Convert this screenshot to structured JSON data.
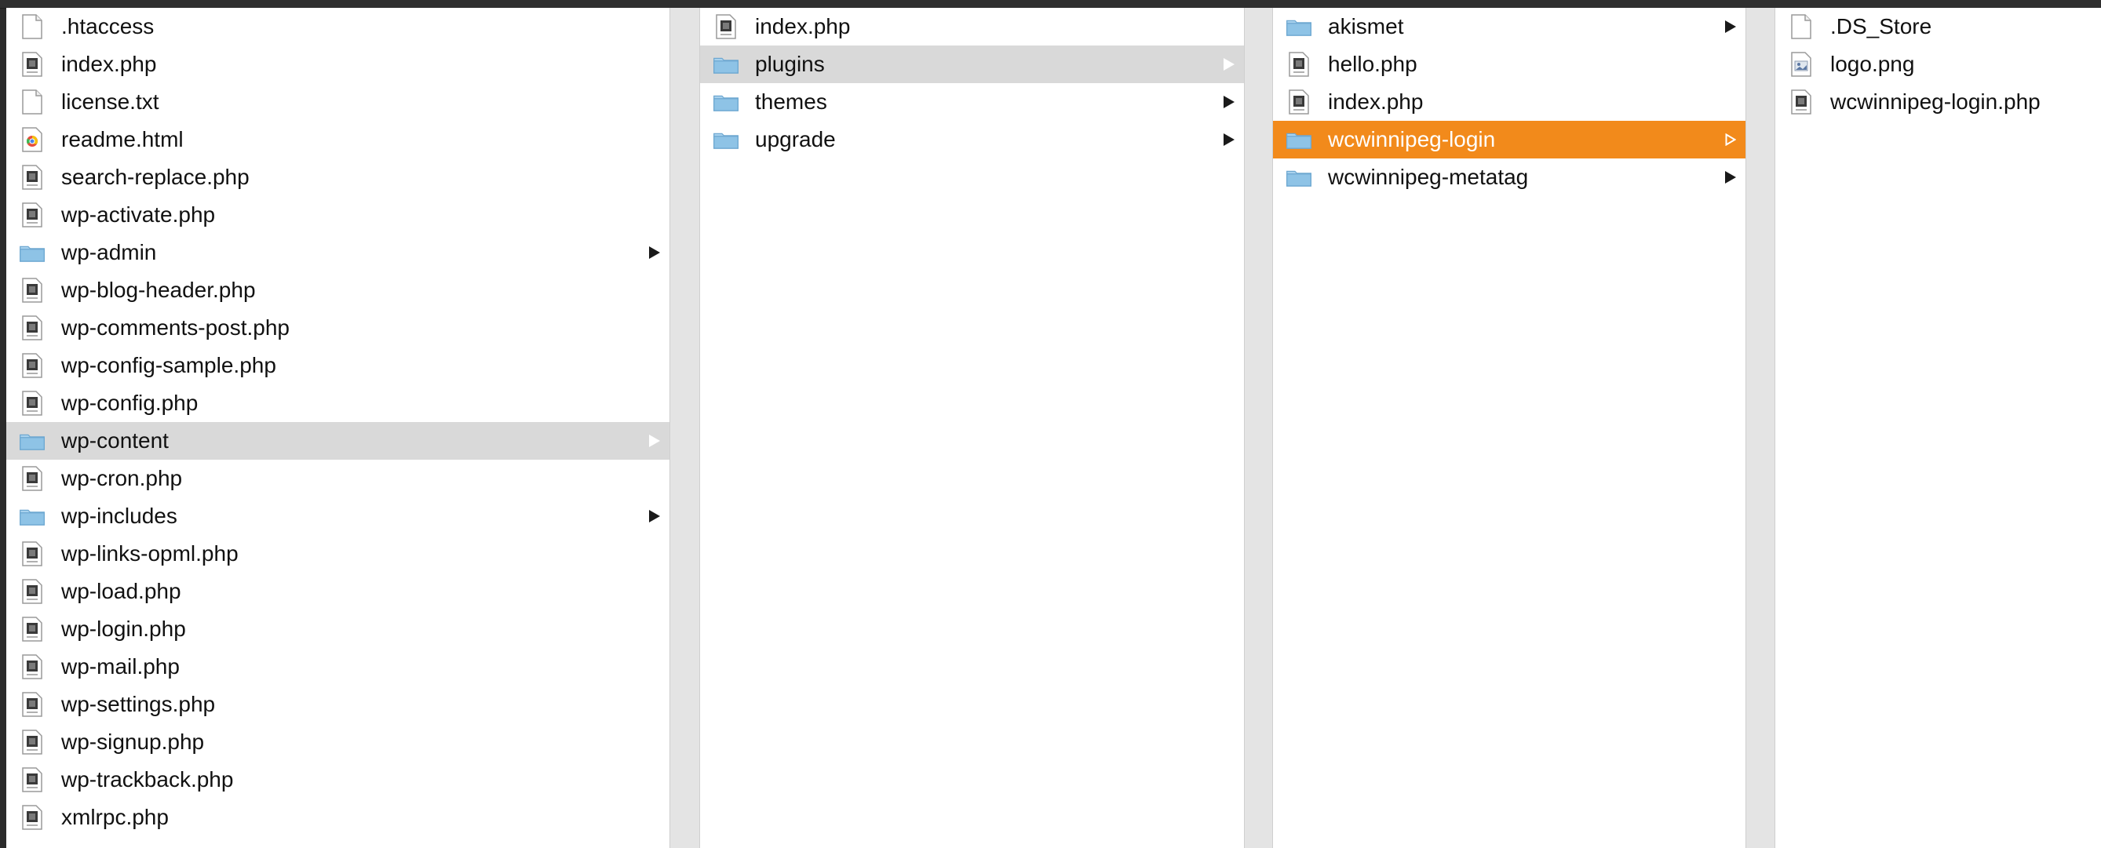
{
  "columns": [
    {
      "items": [
        {
          "name": ".htaccess",
          "type": "file"
        },
        {
          "name": "index.php",
          "type": "php"
        },
        {
          "name": "license.txt",
          "type": "file"
        },
        {
          "name": "readme.html",
          "type": "html"
        },
        {
          "name": "search-replace.php",
          "type": "php"
        },
        {
          "name": "wp-activate.php",
          "type": "php"
        },
        {
          "name": "wp-admin",
          "type": "folder"
        },
        {
          "name": "wp-blog-header.php",
          "type": "php"
        },
        {
          "name": "wp-comments-post.php",
          "type": "php"
        },
        {
          "name": "wp-config-sample.php",
          "type": "php"
        },
        {
          "name": "wp-config.php",
          "type": "php"
        },
        {
          "name": "wp-content",
          "type": "folder",
          "selected": "gray"
        },
        {
          "name": "wp-cron.php",
          "type": "php"
        },
        {
          "name": "wp-includes",
          "type": "folder"
        },
        {
          "name": "wp-links-opml.php",
          "type": "php"
        },
        {
          "name": "wp-load.php",
          "type": "php"
        },
        {
          "name": "wp-login.php",
          "type": "php"
        },
        {
          "name": "wp-mail.php",
          "type": "php"
        },
        {
          "name": "wp-settings.php",
          "type": "php"
        },
        {
          "name": "wp-signup.php",
          "type": "php"
        },
        {
          "name": "wp-trackback.php",
          "type": "php"
        },
        {
          "name": "xmlrpc.php",
          "type": "php"
        }
      ]
    },
    {
      "items": [
        {
          "name": "index.php",
          "type": "php"
        },
        {
          "name": "plugins",
          "type": "folder",
          "selected": "gray"
        },
        {
          "name": "themes",
          "type": "folder"
        },
        {
          "name": "upgrade",
          "type": "folder"
        }
      ]
    },
    {
      "items": [
        {
          "name": "akismet",
          "type": "folder"
        },
        {
          "name": "hello.php",
          "type": "php"
        },
        {
          "name": "index.php",
          "type": "php"
        },
        {
          "name": "wcwinnipeg-login",
          "type": "folder",
          "selected": "orange"
        },
        {
          "name": "wcwinnipeg-metatag",
          "type": "folder"
        }
      ]
    },
    {
      "items": [
        {
          "name": ".DS_Store",
          "type": "file"
        },
        {
          "name": "logo.png",
          "type": "image"
        },
        {
          "name": "wcwinnipeg-login.php",
          "type": "php"
        }
      ]
    }
  ],
  "colors": {
    "selection_active": "#f28a1b",
    "selection_inactive": "#d9d9d9",
    "folder": "#8ec3e6"
  }
}
